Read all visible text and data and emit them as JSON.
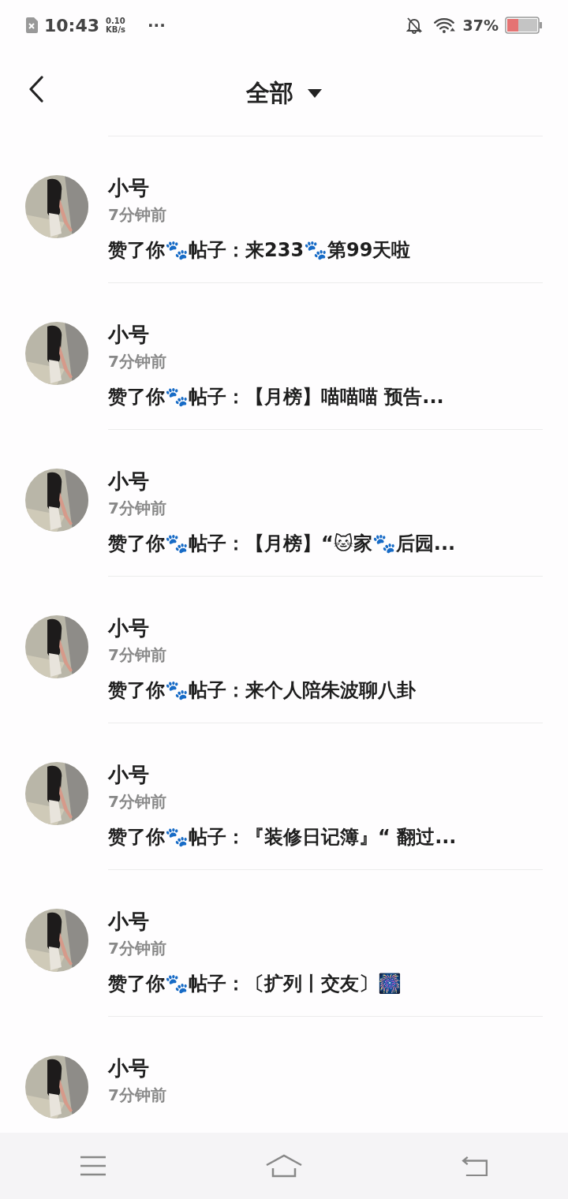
{
  "status_bar": {
    "time": "10:43",
    "speed": "0.10",
    "speed_unit": "KB/s",
    "more": "···",
    "battery": "37%"
  },
  "header": {
    "title": "全部"
  },
  "notifications": [
    {
      "name": "小号",
      "time": "7分钟前",
      "text": "赞了你🐾帖子：来233🐾第99天啦"
    },
    {
      "name": "小号",
      "time": "7分钟前",
      "text": "赞了你🐾帖子：【月榜】喵喵喵 预告..."
    },
    {
      "name": "小号",
      "time": "7分钟前",
      "text": "赞了你🐾帖子：【月榜】“🐱家🐾后园..."
    },
    {
      "name": "小号",
      "time": "7分钟前",
      "text": "赞了你🐾帖子：来个人陪朱波聊八卦"
    },
    {
      "name": "小号",
      "time": "7分钟前",
      "text": "赞了你🐾帖子：『装修日记簿』“ 翻过..."
    },
    {
      "name": "小号",
      "time": "7分钟前",
      "text": "赞了你🐾帖子：〔扩列丨交友〕🎆"
    },
    {
      "name": "小号",
      "time": "7分钟前"
    }
  ]
}
